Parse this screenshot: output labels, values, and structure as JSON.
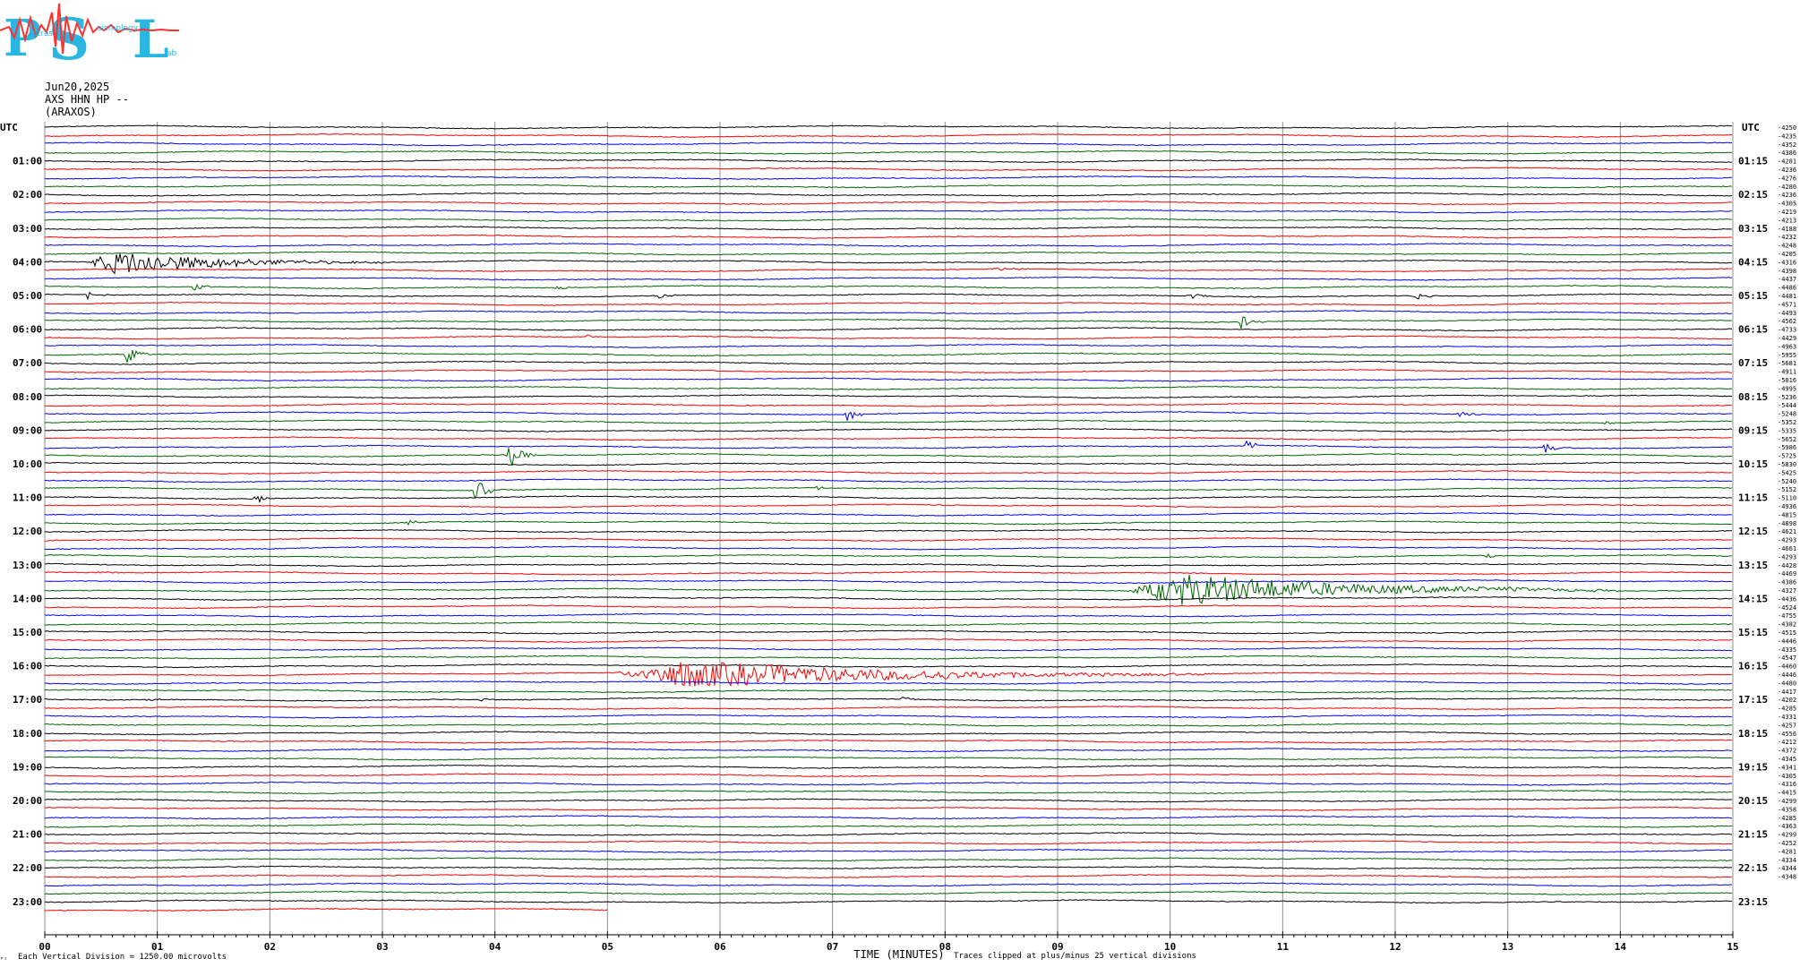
{
  "header": {
    "date": "Jun20,2025",
    "station": "AXS HHN HP --",
    "network": "(ARAXOS)"
  },
  "footer": {
    "left_note": "Each Vertical Division = 1250.00 microvolts",
    "corner_mark": "ᴾˢ",
    "center_label": "TIME (MINUTES)",
    "right_note": "Traces clipped at plus/minus 25 vertical divisions"
  },
  "colors": {
    "trace_cycle": [
      "#000000",
      "#ff0000",
      "#0000ff",
      "#006400"
    ],
    "grid": "#909090",
    "logo_cyan": "#29b6e0",
    "logo_red": "#ff3030"
  },
  "chart_data": {
    "type": "line",
    "title": "",
    "xlabel": "TIME (MINUTES)",
    "ylabel": "",
    "xlim": [
      0,
      15
    ],
    "x_ticks": [
      "00",
      "01",
      "02",
      "03",
      "04",
      "05",
      "06",
      "07",
      "08",
      "09",
      "10",
      "11",
      "12",
      "13",
      "14",
      "15"
    ],
    "utc_header": "UTC",
    "left_hours": [
      "01:00",
      "02:00",
      "03:00",
      "04:00",
      "05:00",
      "06:00",
      "07:00",
      "08:00",
      "09:00",
      "10:00",
      "11:00",
      "12:00",
      "13:00",
      "14:00",
      "15:00",
      "16:00",
      "17:00",
      "18:00",
      "19:00",
      "20:00",
      "21:00",
      "22:00",
      "23:00"
    ],
    "right_hours": [
      "01:15",
      "02:15",
      "03:15",
      "04:15",
      "05:15",
      "06:15",
      "07:15",
      "08:15",
      "09:15",
      "10:15",
      "11:15",
      "12:15",
      "13:15",
      "14:15",
      "15:15",
      "16:15",
      "17:15",
      "18:15",
      "19:15",
      "20:15",
      "21:15",
      "22:15",
      "23:15"
    ],
    "trace_offsets": [
      "-4250",
      "-4235",
      "-4352",
      "-4386",
      "-4281",
      "-4236",
      "-4276",
      "-4280",
      "-4236",
      "-4305",
      "-4219",
      "-4213",
      "-4188",
      "-4232",
      "-4248",
      "-4205",
      "-4316",
      "-4398",
      "-4437",
      "-4486",
      "-4481",
      "-4571",
      "-4493",
      "-4562",
      "-4733",
      "-4429",
      "-4963",
      "-5955",
      "-5681",
      "-4911",
      "-5016",
      "-4995",
      "-5236",
      "-5444",
      "-5248",
      "-5352",
      "-5335",
      "-5652",
      "-5986",
      "-5725",
      "-5830",
      "-5425",
      "-5240",
      "-5152",
      "-5110",
      "-4936",
      "-4815",
      "-4898",
      "-4621",
      "-4293",
      "-4661",
      "-4293",
      "-4428",
      "-4469",
      "-4386",
      "-4327",
      "-4436",
      "-4524",
      "-4755",
      "-4382",
      "-4515",
      "-4446",
      "-4335",
      "-4547",
      "-4460",
      "-4446",
      "-4480",
      "-4417",
      "-4202",
      "-4285",
      "-4331",
      "-4257",
      "-4556",
      "-4212",
      "-4372",
      "-4345",
      "-4341",
      "-4305",
      "-4316",
      "-4415",
      "-4299",
      "-4358",
      "-4285",
      "-4363",
      "-4299",
      "-4252",
      "-4281",
      "-4334",
      "-4344",
      "-4348"
    ],
    "trace_count": 94,
    "last_trace_end_minute": 5.0,
    "events": [
      {
        "trace": 16,
        "minute_start": 0.35,
        "minute_end": 3.0,
        "amplitude": 14
      },
      {
        "trace": 17,
        "minute_start": 8.4,
        "minute_end": 9.1,
        "amplitude": 2
      },
      {
        "trace": 19,
        "minute_start": 1.3,
        "minute_end": 1.55,
        "amplitude": 4
      },
      {
        "trace": 19,
        "minute_start": 4.5,
        "minute_end": 4.75,
        "amplitude": 4
      },
      {
        "trace": 20,
        "minute_start": 0.35,
        "minute_end": 0.6,
        "amplitude": 5
      },
      {
        "trace": 20,
        "minute_start": 5.4,
        "minute_end": 5.7,
        "amplitude": 6
      },
      {
        "trace": 20,
        "minute_start": 10.15,
        "minute_end": 10.4,
        "amplitude": 7
      },
      {
        "trace": 20,
        "minute_start": 12.15,
        "minute_end": 12.4,
        "amplitude": 6
      },
      {
        "trace": 23,
        "minute_start": 10.6,
        "minute_end": 10.85,
        "amplitude": 8
      },
      {
        "trace": 25,
        "minute_start": 4.8,
        "minute_end": 5.0,
        "amplitude": 3
      },
      {
        "trace": 27,
        "minute_start": 0.7,
        "minute_end": 0.95,
        "amplitude": 12
      },
      {
        "trace": 34,
        "minute_start": 7.1,
        "minute_end": 7.35,
        "amplitude": 9
      },
      {
        "trace": 34,
        "minute_start": 12.55,
        "minute_end": 12.8,
        "amplitude": 6
      },
      {
        "trace": 35,
        "minute_start": 13.85,
        "minute_end": 14.1,
        "amplitude": 3
      },
      {
        "trace": 38,
        "minute_start": 10.65,
        "minute_end": 10.9,
        "amplitude": 6
      },
      {
        "trace": 38,
        "minute_start": 13.3,
        "minute_end": 13.55,
        "amplitude": 7
      },
      {
        "trace": 39,
        "minute_start": 4.1,
        "minute_end": 4.4,
        "amplitude": 14
      },
      {
        "trace": 43,
        "minute_start": 3.8,
        "minute_end": 4.1,
        "amplitude": 16
      },
      {
        "trace": 43,
        "minute_start": 6.85,
        "minute_end": 7.0,
        "amplitude": 3
      },
      {
        "trace": 44,
        "minute_start": 1.85,
        "minute_end": 2.05,
        "amplitude": 8
      },
      {
        "trace": 47,
        "minute_start": 3.2,
        "minute_end": 3.5,
        "amplitude": 4
      },
      {
        "trace": 51,
        "minute_start": 12.8,
        "minute_end": 12.95,
        "amplitude": 4
      },
      {
        "trace": 53,
        "minute_start": 0.45,
        "minute_end": 0.8,
        "amplitude": 2
      },
      {
        "trace": 55,
        "minute_start": 9.6,
        "minute_end": 14.0,
        "amplitude": 18
      },
      {
        "trace": 65,
        "minute_start": 5.05,
        "minute_end": 10.5,
        "amplitude": 16
      },
      {
        "trace": 68,
        "minute_start": 0.9,
        "minute_end": 1.1,
        "amplitude": 3
      },
      {
        "trace": 68,
        "minute_start": 3.85,
        "minute_end": 4.05,
        "amplitude": 2
      },
      {
        "trace": 68,
        "minute_start": 7.6,
        "minute_end": 7.8,
        "amplitude": 4
      }
    ]
  }
}
